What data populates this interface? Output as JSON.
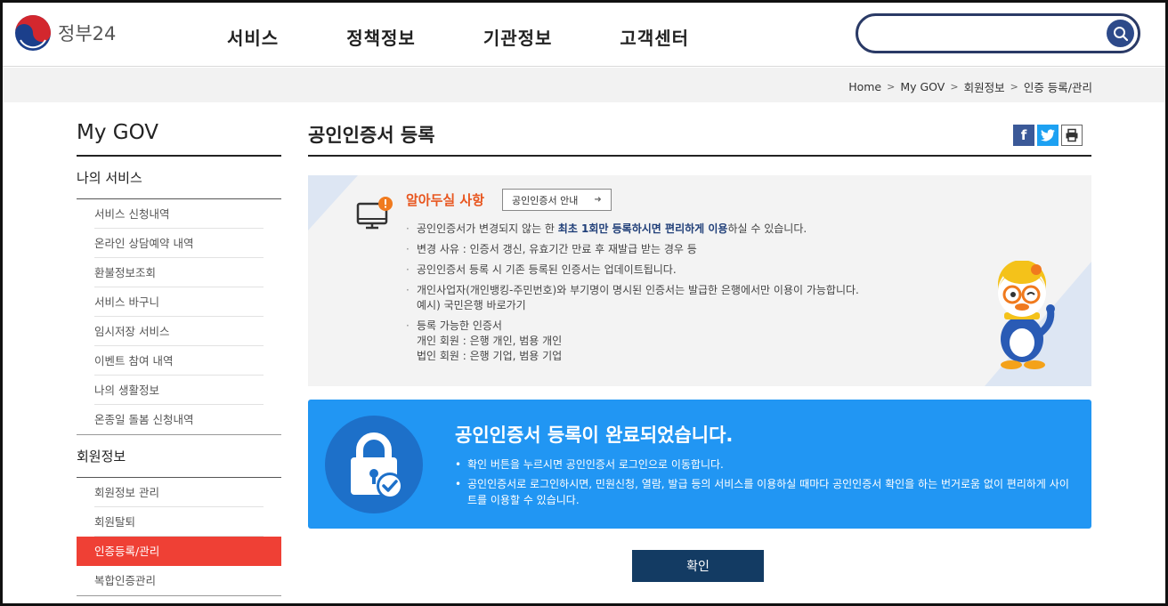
{
  "header": {
    "logo_text": "정부24",
    "nav": [
      "서비스",
      "정책정보",
      "기관정보",
      "고객센터"
    ],
    "search_placeholder": ""
  },
  "breadcrumb": [
    "Home",
    "My GOV",
    "회원정보",
    "인증 등록/관리"
  ],
  "sidebar": {
    "title": "My GOV",
    "groups": [
      {
        "label": "나의 서비스",
        "items": [
          "서비스 신청내역",
          "온라인 상담예약 내역",
          "환불정보조회",
          "서비스 바구니",
          "임시저장 서비스",
          "이벤트 참여 내역",
          "나의 생활정보",
          "온종일 돌봄 신청내역"
        ]
      },
      {
        "label": "회원정보",
        "items": [
          "회원정보 관리",
          "회원탈퇴",
          "인증등록/관리",
          "복합인증관리"
        ]
      }
    ],
    "active_item": "인증등록/관리"
  },
  "content": {
    "title": "공인인증서 등록",
    "share": {
      "facebook": "f",
      "twitter": "t",
      "print": "print"
    },
    "notice": {
      "heading": "알아두실 사항",
      "guide_button": "공인인증서 안내",
      "items": [
        {
          "pre": "공인인증서가 변경되지 않는 한 ",
          "bold": "최초 1회만 등록하시면 편리하게 이용",
          "post": "하실 수 있습니다."
        },
        {
          "line1": "변경 사유 : 인증서 갱신, 유효기간 만료 후 재발급 받는 경우 등"
        },
        {
          "line1": "공인인증서 등록 시 기존 등록된 인증서는 업데이트됩니다."
        },
        {
          "line1": "개인사업자(개인뱅킹-주민번호)와 부기명이 명시된 인증서는 발급한 은행에서만 이용이 가능합니다.",
          "line2": "예시) 국민은행 바로가기"
        },
        {
          "line1": "등록 가능한 인증서",
          "line2": "개인 회원 : 은행 개인, 범용 개인",
          "line3": "법인 회원 : 은행 기업, 범용 기업"
        }
      ]
    },
    "complete": {
      "title": "공인인증서 등록이 완료되었습니다.",
      "items": [
        "확인 버튼을 누르시면 공인인증서 로그인으로 이동합니다.",
        "공인인증서로 로그인하시면, 민원신청, 열람, 발급 등의 서비스를 이용하실 때마다 공인인증서 확인을 하는 번거로움 없이 편리하게 사이트를 이용할 수 있습니다."
      ]
    },
    "confirm_button": "확인"
  },
  "colors": {
    "accent_red": "#ef4035",
    "banner_blue": "#2196f3",
    "confirm_navy": "#133b63",
    "notice_orange": "#e8561f"
  }
}
